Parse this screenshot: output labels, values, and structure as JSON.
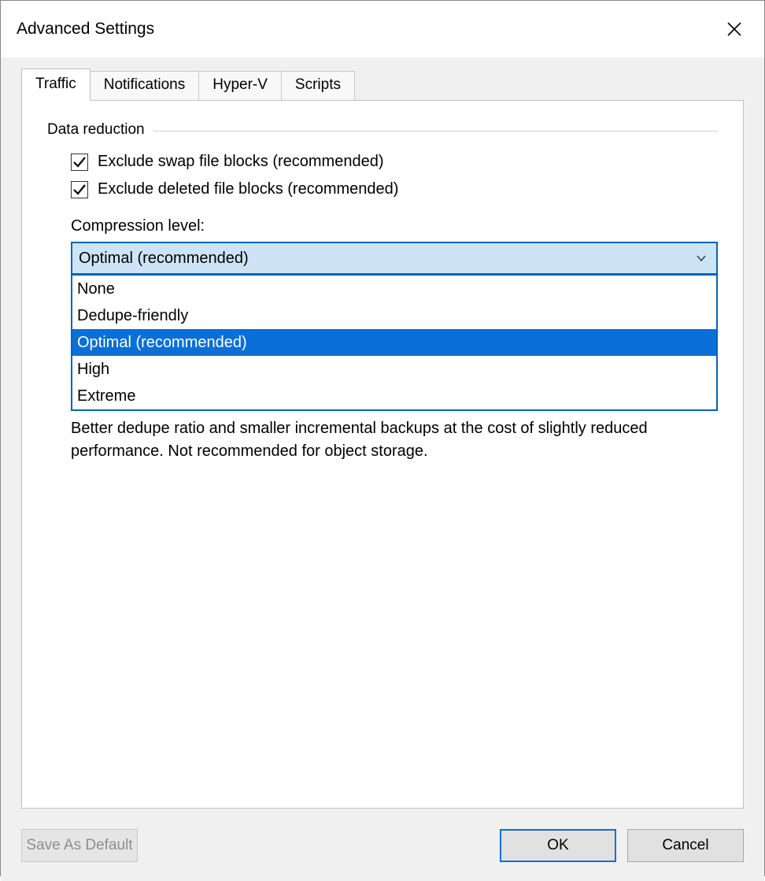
{
  "window": {
    "title": "Advanced Settings"
  },
  "tabs": [
    {
      "label": "Traffic"
    },
    {
      "label": "Notifications"
    },
    {
      "label": "Hyper-V"
    },
    {
      "label": "Scripts"
    }
  ],
  "group": {
    "title": "Data reduction"
  },
  "checkboxes": {
    "swap": {
      "label": "Exclude swap file blocks (recommended)",
      "checked": true
    },
    "deleted": {
      "label": "Exclude deleted file blocks (recommended)",
      "checked": true
    }
  },
  "compression": {
    "label": "Compression level:",
    "selected": "Optimal (recommended)",
    "options": [
      "None",
      "Dedupe-friendly",
      "Optimal (recommended)",
      "High",
      "Extreme"
    ]
  },
  "description": "Better dedupe ratio and smaller incremental backups at the cost of slightly reduced performance. Not recommended for object storage.",
  "buttons": {
    "save_default": "Save As Default",
    "ok": "OK",
    "cancel": "Cancel"
  }
}
